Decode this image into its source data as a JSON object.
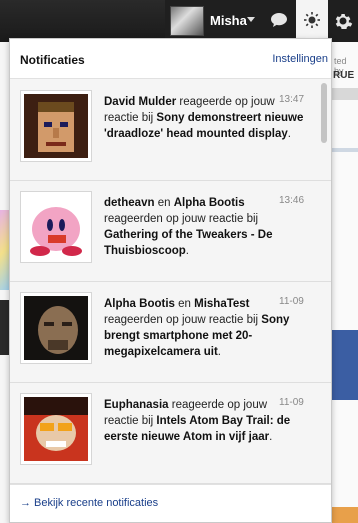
{
  "topbar": {
    "user_name": "Misha",
    "icons": [
      "user-avatar",
      "chevron-down-icon",
      "chat-icon",
      "notifications-icon",
      "gear-icon"
    ]
  },
  "background": {
    "right_text": "ted by",
    "right_logo": "RUE"
  },
  "panel": {
    "title": "Notificaties",
    "settings_label": "Instellingen",
    "footer_label": "→ Bekijk recente notificaties",
    "items": [
      {
        "actors": [
          "David Mulder"
        ],
        "connector": "",
        "verb": "reageerde op jouw reactie bij",
        "target": "Sony demonstreert nieuwe 'draadloze' head mounted display",
        "end": ".",
        "time": "13:47"
      },
      {
        "actors": [
          "detheavn",
          "Alpha Bootis"
        ],
        "connector": "en",
        "verb": "reageerden op jouw reactie bij",
        "target": "Gathering of the Tweakers - De Thuisbioscoop",
        "end": ".",
        "time": "13:46"
      },
      {
        "actors": [
          "Alpha Bootis",
          "MishaTest"
        ],
        "connector": "en",
        "verb": "reageerden op jouw reactie bij",
        "target": "Sony brengt smartphone met 20-megapixelcamera uit",
        "end": ".",
        "time": "11-09"
      },
      {
        "actors": [
          "Euphanasia"
        ],
        "connector": "",
        "verb": "reageerde op jouw reactie bij",
        "target": "Intels Atom Bay Trail: de eerste nieuwe Atom in vijf jaar",
        "end": ".",
        "time": "11-09"
      }
    ]
  }
}
